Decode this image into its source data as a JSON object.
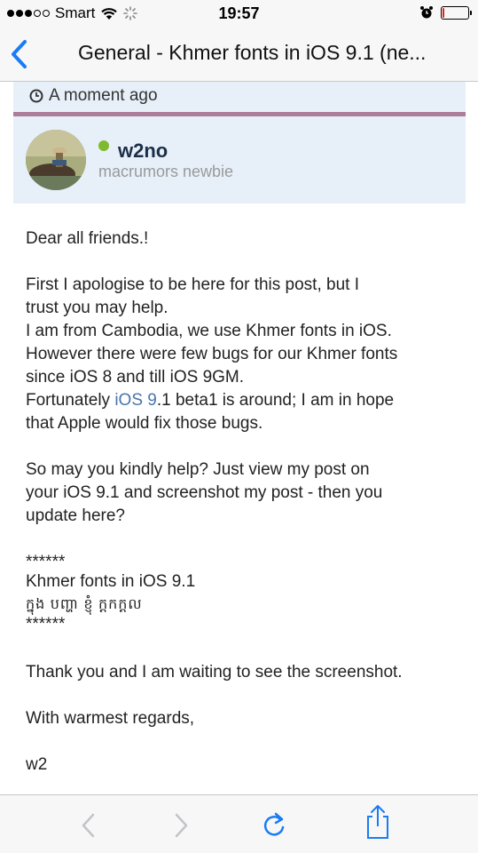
{
  "status_bar": {
    "carrier": "Smart",
    "time": "19:57"
  },
  "nav": {
    "title": "General - Khmer fonts in iOS 9.1 (ne..."
  },
  "post": {
    "timestamp": "A moment ago",
    "author": {
      "name": "w2no",
      "title": "macrumors newbie",
      "status": "online"
    },
    "body": {
      "greeting": "Dear all friends.!",
      "p2_line1": "First I apologise to be here for this post, but I",
      "p2_line2": "trust you may help.",
      "p2_line3": "I am from Cambodia, we use Khmer fonts in iOS.",
      "p2_line4": "However there were few bugs for our Khmer fonts",
      "p2_line5": "since iOS 8 and till iOS 9GM.",
      "p2_line6_pre": "Fortunately ",
      "p2_line6_link": "iOS 9",
      "p2_line6_post": ".1 beta1 is around; I am in hope",
      "p2_line7": "that Apple would fix those bugs.",
      "p3_line1": "So may you kindly help? Just view my post on",
      "p3_line2": "your iOS 9.1 and screenshot my post - then you",
      "p3_line3": "update here?",
      "stars1": "******",
      "font_label": "Khmer fonts in iOS 9.1",
      "khmer_text": "ក្នុង បញ្ហា ខ្ញុំ ក្តកក្តល",
      "stars2": "******",
      "thanks": "Thank you and I am waiting to see the screenshot.",
      "regards": "With warmest regards,",
      "signature": "w2"
    }
  },
  "colors": {
    "accent": "#1a7cf5",
    "meta_bg": "#e7f0f9",
    "divider": "#ac7d99",
    "online": "#7fba2e",
    "link": "#4a75aa",
    "battery_low": "#e0201c"
  },
  "icons": {
    "back": "chevron-left-icon",
    "forward": "chevron-right-icon",
    "reload": "reload-icon",
    "share": "share-icon",
    "clock": "clock-icon",
    "wifi": "wifi-icon",
    "loading": "activity-spinner-icon",
    "alarm": "alarm-clock-icon",
    "battery": "battery-icon"
  },
  "battery_level": 0.08
}
